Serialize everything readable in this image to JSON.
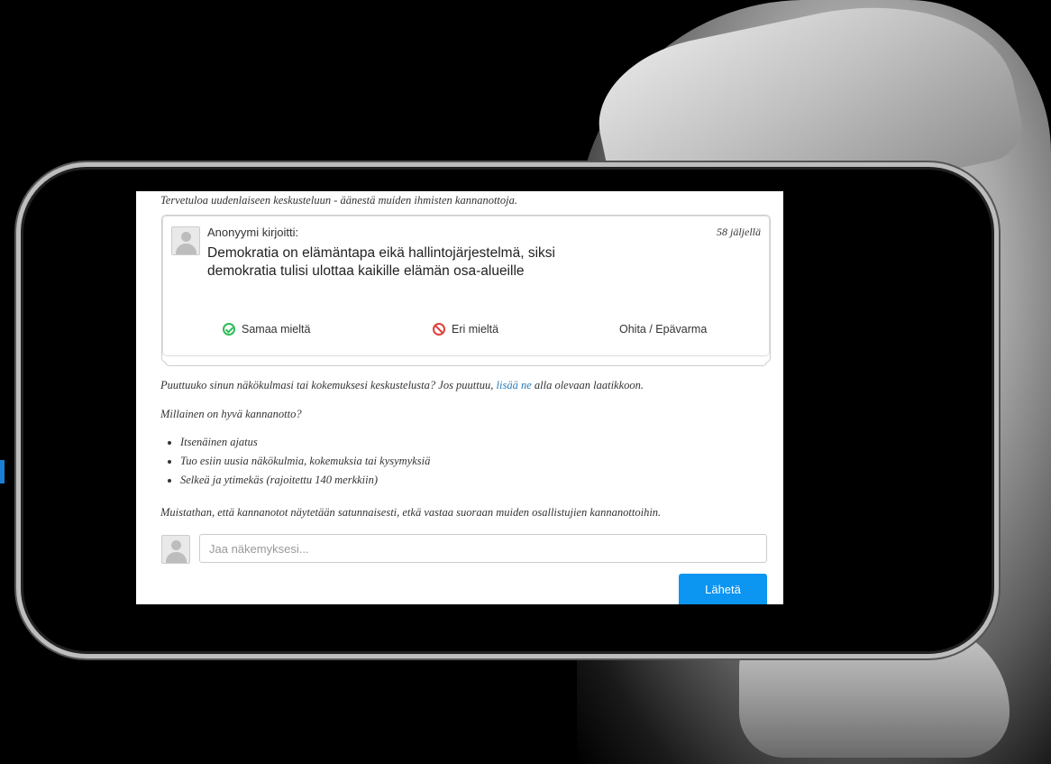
{
  "intro": "Tervetuloa uudenlaiseen keskusteluun - äänestä muiden ihmisten kannanottoja.",
  "card": {
    "author": "Anonyymi kirjoitti:",
    "remaining": "58 jäljellä",
    "statement": "Demokratia on elämäntapa eikä hallintojärjestelmä, siksi demokratia tulisi ulottaa kaikille elämän osa-alueille",
    "agree_label": "Samaa mieltä",
    "disagree_label": "Eri mieltä",
    "pass_label": "Ohita / Epävarma",
    "agree_icon": "check-circle-icon",
    "disagree_icon": "ban-icon",
    "agree_color": "#2ebd59",
    "disagree_color": "#e0413a"
  },
  "prompt": {
    "before_link": "Puuttuuko sinun näkökulmasi tai kokemuksesi keskustelusta? Jos puuttuu,",
    "link": "lisää ne",
    "after_link": "alla olevaan laatikkoon."
  },
  "guidelines": {
    "heading": "Millainen on hyvä kannanotto?",
    "items": [
      "Itsenäinen ajatus",
      "Tuo esiin uusia näkökulmia, kokemuksia tai kysymyksiä",
      "Selkeä ja ytimekäs (rajoitettu 140 merkkiin)"
    ]
  },
  "reminder": "Muistathan, että kannanotot näytetään satunnaisesti, etkä vastaa suoraan muiden osallistujien kannanottoihin.",
  "compose": {
    "placeholder": "Jaa näkemyksesi...",
    "submit_label": "Lähetä"
  },
  "colors": {
    "submit_bg": "#0d95f2",
    "link": "#2a7ab8"
  }
}
